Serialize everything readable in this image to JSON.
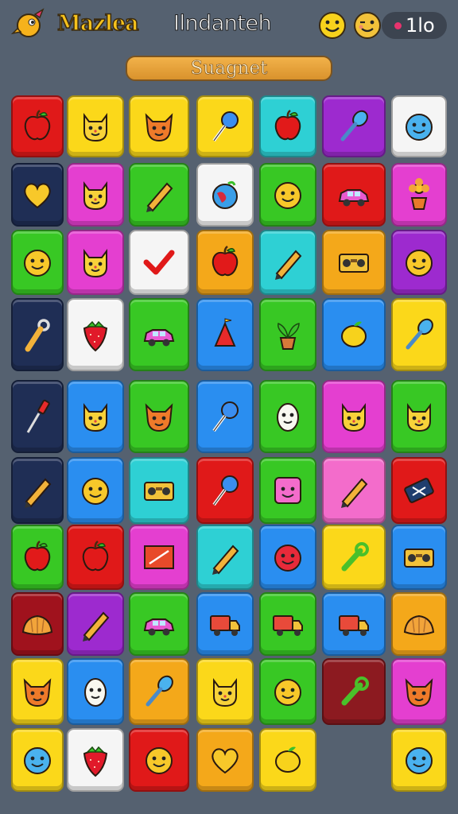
{
  "header": {
    "brand": "Mazlea",
    "title": "Ilndanteh",
    "counter": "1lo",
    "banner": "Suagnet"
  },
  "colors": {
    "background": "#556170",
    "red": "#e01919",
    "darkred": "#a0121d",
    "yellow": "#fbd81a",
    "orange": "#f4a81a",
    "cyan": "#2ed0d4",
    "purple": "#9d2acf",
    "white": "#f5f5f5",
    "navy": "#1f2e55",
    "magenta": "#e43fd0",
    "green": "#38c824",
    "blue": "#2a8ef0",
    "pink": "#f36ccb",
    "maroon": "#8c1a20"
  },
  "board": {
    "rows": [
      [
        {
          "bg": "red",
          "icon": "apple-icon"
        },
        {
          "bg": "yellow",
          "icon": "cat-face-icon"
        },
        {
          "bg": "yellow",
          "icon": "fox-face-icon"
        },
        {
          "bg": "yellow",
          "icon": "lollipop-icon"
        },
        {
          "bg": "cyan",
          "icon": "apple-icon"
        },
        {
          "bg": "purple",
          "icon": "spoon-icon"
        },
        {
          "bg": "white",
          "icon": "blue-face-icon"
        }
      ],
      [
        {
          "bg": "navy",
          "icon": "heart-icon"
        },
        {
          "bg": "magenta",
          "icon": "cat-face-icon"
        },
        {
          "bg": "green",
          "icon": "pencil-icon"
        },
        {
          "bg": "white",
          "icon": "globe-icon"
        },
        {
          "bg": "green",
          "icon": "orange-face-icon"
        },
        {
          "bg": "red",
          "icon": "car-icon"
        },
        {
          "bg": "magenta",
          "icon": "flower-pot-icon"
        }
      ],
      [
        {
          "bg": "green",
          "icon": "orange-face-icon"
        },
        {
          "bg": "magenta",
          "icon": "cat-face-icon"
        },
        {
          "bg": "white",
          "icon": "check-icon"
        },
        {
          "bg": "orange",
          "icon": "apple-icon"
        },
        {
          "bg": "cyan",
          "icon": "pencil-icon"
        },
        {
          "bg": "orange",
          "icon": "radio-icon"
        },
        {
          "bg": "purple",
          "icon": "orange-face-icon"
        }
      ],
      [
        {
          "bg": "navy",
          "icon": "key-icon"
        },
        {
          "bg": "white",
          "icon": "strawberry-icon"
        },
        {
          "bg": "green",
          "icon": "car-icon"
        },
        {
          "bg": "blue",
          "icon": "bell-icon"
        },
        {
          "bg": "green",
          "icon": "plant-pot-icon"
        },
        {
          "bg": "blue",
          "icon": "lemon-icon"
        },
        {
          "bg": "yellow",
          "icon": "spoon-icon"
        }
      ],
      [
        {
          "bg": "navy",
          "icon": "screwdriver-icon"
        },
        {
          "bg": "blue",
          "icon": "cat-face-icon"
        },
        {
          "bg": "green",
          "icon": "fox-face-icon"
        },
        {
          "bg": "blue",
          "icon": "lollipop-icon"
        },
        {
          "bg": "green",
          "icon": "egg-face-icon"
        },
        {
          "bg": "magenta",
          "icon": "cat-face-icon"
        },
        {
          "bg": "green",
          "icon": "cat-face-icon"
        }
      ],
      [
        {
          "bg": "navy",
          "icon": "pencil-icon"
        },
        {
          "bg": "blue",
          "icon": "orange-face-icon"
        },
        {
          "bg": "cyan",
          "icon": "radio-icon"
        },
        {
          "bg": "red",
          "icon": "lollipop-icon"
        },
        {
          "bg": "green",
          "icon": "pink-face-icon"
        },
        {
          "bg": "pink",
          "icon": "pencil-icon"
        },
        {
          "bg": "red",
          "icon": "eraser-icon"
        }
      ],
      [
        {
          "bg": "green",
          "icon": "apple-icon"
        },
        {
          "bg": "red",
          "icon": "apple-icon"
        },
        {
          "bg": "magenta",
          "icon": "picture-frame-icon"
        },
        {
          "bg": "cyan",
          "icon": "pencil-icon"
        },
        {
          "bg": "blue",
          "icon": "red-face-icon"
        },
        {
          "bg": "yellow",
          "icon": "wrench-icon"
        },
        {
          "bg": "blue",
          "icon": "radio-icon"
        }
      ],
      [
        {
          "bg": "darkred",
          "icon": "croissant-icon"
        },
        {
          "bg": "purple",
          "icon": "pencil-icon"
        },
        {
          "bg": "green",
          "icon": "car-icon"
        },
        {
          "bg": "blue",
          "icon": "truck-icon"
        },
        {
          "bg": "green",
          "icon": "truck-icon"
        },
        {
          "bg": "blue",
          "icon": "truck-icon"
        },
        {
          "bg": "orange",
          "icon": "croissant-icon"
        }
      ],
      [
        {
          "bg": "yellow",
          "icon": "fox-face-icon"
        },
        {
          "bg": "blue",
          "icon": "egg-face-icon"
        },
        {
          "bg": "orange",
          "icon": "spoon-icon"
        },
        {
          "bg": "yellow",
          "icon": "cat-face-icon"
        },
        {
          "bg": "green",
          "icon": "orange-face-icon"
        },
        {
          "bg": "maroon",
          "icon": "wrench-icon"
        },
        {
          "bg": "magenta",
          "icon": "fox-face-icon"
        }
      ],
      [
        {
          "bg": "yellow",
          "icon": "blue-face-icon"
        },
        {
          "bg": "white",
          "icon": "strawberry-icon"
        },
        {
          "bg": "red",
          "icon": "orange-face-icon"
        },
        {
          "bg": "orange",
          "icon": "heart-icon"
        },
        {
          "bg": "yellow",
          "icon": "lemon-icon"
        },
        null,
        {
          "bg": "yellow",
          "icon": "blue-face-icon"
        }
      ]
    ]
  }
}
